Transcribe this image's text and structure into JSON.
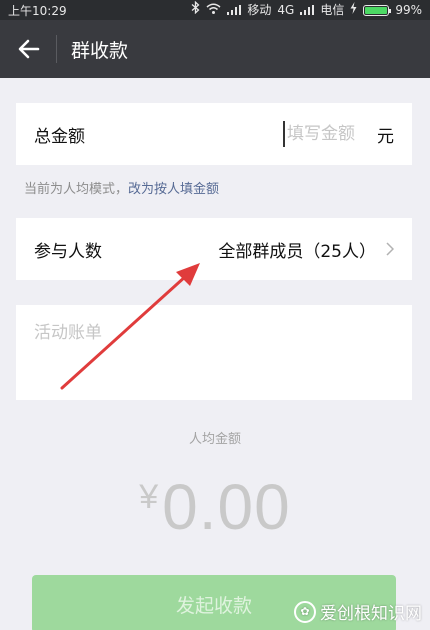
{
  "status_bar": {
    "time": "上午10:29",
    "carrier1": "移动",
    "network": "4G",
    "carrier2": "电信",
    "battery": "99%",
    "battery_level": 0.99,
    "battery_color": "#4cd964"
  },
  "nav": {
    "title": "群收款",
    "back_icon": "arrow-left-icon"
  },
  "amount": {
    "label": "总金额",
    "placeholder": "填写金额",
    "unit": "元"
  },
  "mode_hint": {
    "text": "当前为人均模式，",
    "link": "改为按人填金额"
  },
  "members": {
    "label": "参与人数",
    "value": "全部群成员（25人）"
  },
  "bill": {
    "placeholder": "活动账单"
  },
  "average": {
    "label": "人均金额",
    "currency": "¥",
    "value": "0.00"
  },
  "submit": {
    "label": "发起收款",
    "color": "#9ed99d"
  },
  "watermark": {
    "text": "爱创根知识网"
  },
  "colors": {
    "nav_bg": "#393a3f",
    "page_bg": "#efeff4",
    "link": "#576b95",
    "annotation": "#e03c3c"
  }
}
